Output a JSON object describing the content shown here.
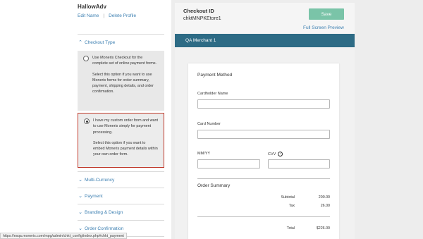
{
  "profile": {
    "name": "HallowAdv",
    "edit_label": "Edit Name",
    "separator": "|",
    "delete_label": "Delete Profile"
  },
  "sections": {
    "checkout_type": "Checkout Type",
    "multi_currency": "Multi-Currency",
    "payment": "Payment",
    "branding": "Branding & Design",
    "order_confirmation": "Order Confirmation"
  },
  "options": [
    {
      "selected": false,
      "title": "Use Moneris Checkout for the complete set of online payment forms.",
      "desc": "Select this option if you want to use Moneris forms for order summary, payment, shipping details, and order confirmation."
    },
    {
      "selected": true,
      "title": "I have my custom order form and want to use Moneris simply for payment processing.",
      "desc": "Select this option if you want to embed Moneris payment details within your own order form."
    }
  ],
  "status_url": "https://esqa.moneris.com/mpg/admin/chkt_config/index.php#chkt_payment",
  "checkout": {
    "label": "Checkout ID",
    "id": "chktMNPKEtore1",
    "save_label": "Save",
    "preview_label": "Full Screen Preview"
  },
  "merchant": "QA Merchant 1",
  "form": {
    "title": "Payment Method",
    "cardholder_label": "Cardholder Name",
    "card_number_label": "Card Number",
    "mmyy_label": "MM/YY",
    "cvv_label": "CVV",
    "cvv_info": "?"
  },
  "summary": {
    "title": "Order Summary",
    "subtotal_label": "Subtotal",
    "subtotal_value": "200.00",
    "tax_label": "Tax",
    "tax_value": "26.00",
    "total_label": "Total",
    "total_value": "$226.00"
  },
  "colors": {
    "link": "#3c7fb1",
    "save_button": "#7ac4a8",
    "merchant_bar": "#2d6b85",
    "selected_border": "#c0392b"
  }
}
